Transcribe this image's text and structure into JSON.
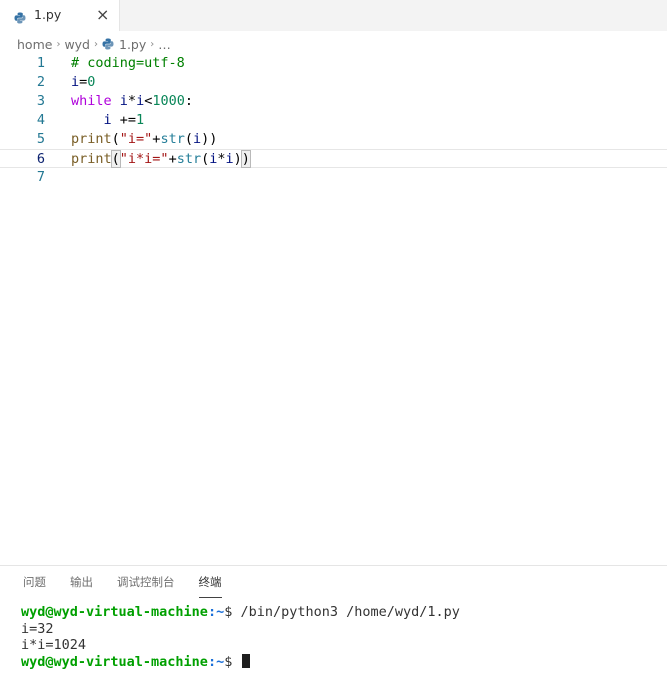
{
  "tabs": [
    {
      "label": "1.py",
      "icon": "python-icon",
      "close": "×"
    }
  ],
  "breadcrumb": {
    "items": [
      "home",
      "wyd",
      "1.py",
      "…"
    ],
    "separator": "›"
  },
  "editor": {
    "current_line": 6,
    "lines": [
      {
        "num": "1",
        "segments": [
          {
            "t": "# coding=utf-8",
            "c": "comment"
          }
        ]
      },
      {
        "num": "2",
        "segments": [
          {
            "t": "i",
            "c": "var"
          },
          {
            "t": "=",
            "c": "plain"
          },
          {
            "t": "0",
            "c": "num"
          }
        ]
      },
      {
        "num": "3",
        "segments": [
          {
            "t": "while",
            "c": "kw"
          },
          {
            "t": " ",
            "c": "plain"
          },
          {
            "t": "i",
            "c": "var"
          },
          {
            "t": "*",
            "c": "plain"
          },
          {
            "t": "i",
            "c": "var"
          },
          {
            "t": "<",
            "c": "plain"
          },
          {
            "t": "1000",
            "c": "num"
          },
          {
            "t": ":",
            "c": "plain"
          }
        ]
      },
      {
        "num": "4",
        "segments": [
          {
            "t": "    i ",
            "c": "var"
          },
          {
            "t": "+=",
            "c": "plain"
          },
          {
            "t": "1",
            "c": "num"
          }
        ]
      },
      {
        "num": "5",
        "segments": [
          {
            "t": "print",
            "c": "fn"
          },
          {
            "t": "(",
            "c": "plain"
          },
          {
            "t": "\"i=\"",
            "c": "str"
          },
          {
            "t": "+",
            "c": "plain"
          },
          {
            "t": "str",
            "c": "builtin"
          },
          {
            "t": "(",
            "c": "plain"
          },
          {
            "t": "i",
            "c": "var"
          },
          {
            "t": "))",
            "c": "plain"
          }
        ]
      },
      {
        "num": "6",
        "segments": [
          {
            "t": "print",
            "c": "fn"
          },
          {
            "t": "(",
            "c": "hl"
          },
          {
            "t": "\"i*i=\"",
            "c": "str"
          },
          {
            "t": "+",
            "c": "plain"
          },
          {
            "t": "str",
            "c": "builtin"
          },
          {
            "t": "(",
            "c": "plain"
          },
          {
            "t": "i",
            "c": "var"
          },
          {
            "t": "*",
            "c": "plain"
          },
          {
            "t": "i",
            "c": "var"
          },
          {
            "t": ")",
            "c": "plain"
          },
          {
            "t": ")",
            "c": "hl"
          }
        ]
      },
      {
        "num": "7",
        "segments": []
      }
    ]
  },
  "panel": {
    "tabs": [
      "问题",
      "输出",
      "调试控制台",
      "终端"
    ],
    "active_tab": 3
  },
  "terminal": {
    "lines": [
      {
        "user": "wyd@wyd-virtual-machine",
        "path": ":~",
        "prompt": "$ ",
        "cmd": "/bin/python3 /home/wyd/1.py"
      },
      {
        "text": "i=32"
      },
      {
        "text": "i*i=1024"
      },
      {
        "user": "wyd@wyd-virtual-machine",
        "path": ":~",
        "prompt": "$ ",
        "cmd": "",
        "cursor": true
      }
    ]
  },
  "colors": {
    "line_number": "#237893",
    "comment": "#008000",
    "keyword": "#af00db",
    "string": "#a31515",
    "number": "#098658",
    "prompt_user": "#00a000",
    "prompt_path": "#1b6fd8"
  }
}
